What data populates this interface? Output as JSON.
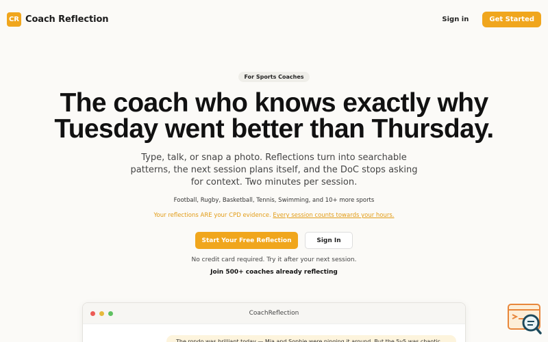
{
  "header": {
    "logo_text": "CR",
    "brand": "Coach Reflection",
    "sign_in": "Sign in",
    "get_started": "Get Started"
  },
  "hero": {
    "badge": "For Sports Coaches",
    "title_line1": "The coach who knows exactly why",
    "title_line2": "Tuesday went better than Thursday.",
    "subtitle": "Type, talk, or snap a photo. Reflections turn into searchable patterns, the next session plans itself, and the DoC stops asking for context. Two minutes per session.",
    "sports": "Football, Rugby, Basketball, Tennis, Swimming, and 10+ more sports",
    "cpd_text": "Your reflections ARE your CPD evidence.",
    "cpd_link": "Every session counts towards your hours.",
    "primary_cta": "Start Your Free Reflection",
    "secondary_cta": "Sign In",
    "note": "No credit card required. Try it after your next session.",
    "join": "Join 500+ coaches already reflecting"
  },
  "preview": {
    "window_title": "CoachReflection",
    "message": "The rondo was brilliant today — Mia and Sophie were pinging it around. But the 5v5 was chaotic"
  },
  "colors": {
    "accent": "#f0a61d",
    "background": "#fbfaf7"
  },
  "icons": {
    "chat_widget": "chat-search-icon"
  }
}
